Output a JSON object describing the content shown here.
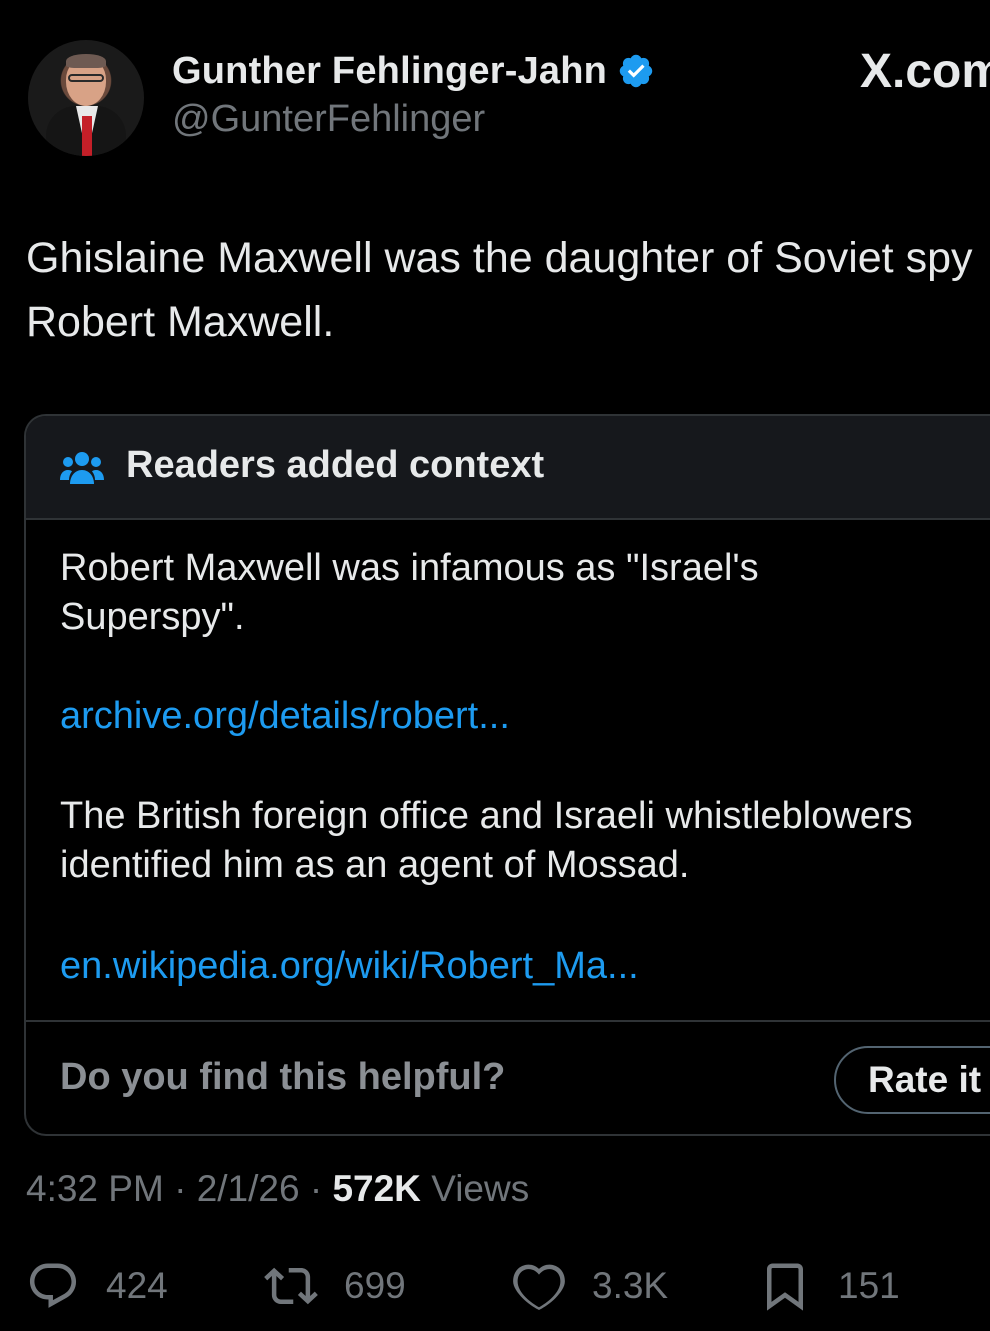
{
  "author": {
    "display_name": "Gunther Fehlinger-Jahn",
    "handle": "@GunterFehlinger",
    "verified_color": "#1d9bf0"
  },
  "brand": "X.com",
  "tweet": {
    "text": "Ghislaine Maxwell was the daughter of Soviet spy Robert Maxwell."
  },
  "community_note": {
    "title": "Readers added context",
    "paragraph_1_line_1": "Robert Maxwell was infamous as \"Israel's",
    "paragraph_1_line_2": "Superspy\".",
    "link_1": "archive.org/details/robert...",
    "paragraph_2_line_1": "The British foreign office and Israeli whistleblowers",
    "paragraph_2_line_2": "identified him as an agent of Mossad.",
    "link_2": "en.wikipedia.org/wiki/Robert_Ma...",
    "helpful_question": "Do you find this helpful?",
    "rate_label": "Rate it"
  },
  "meta": {
    "time": "4:32 PM",
    "separator": "·",
    "date": "2/1/26",
    "views_count": "572K",
    "views_label": "Views"
  },
  "actions": {
    "replies": "424",
    "reposts": "699",
    "likes": "3.3K",
    "bookmarks": "151"
  },
  "colors": {
    "background": "#000000",
    "text": "#e7e9ea",
    "muted": "#71767b",
    "link": "#1d9bf0",
    "border": "#2f3336"
  },
  "icons": [
    "verified-badge-icon",
    "people-icon",
    "reply-icon",
    "repost-icon",
    "like-icon",
    "bookmark-icon"
  ]
}
